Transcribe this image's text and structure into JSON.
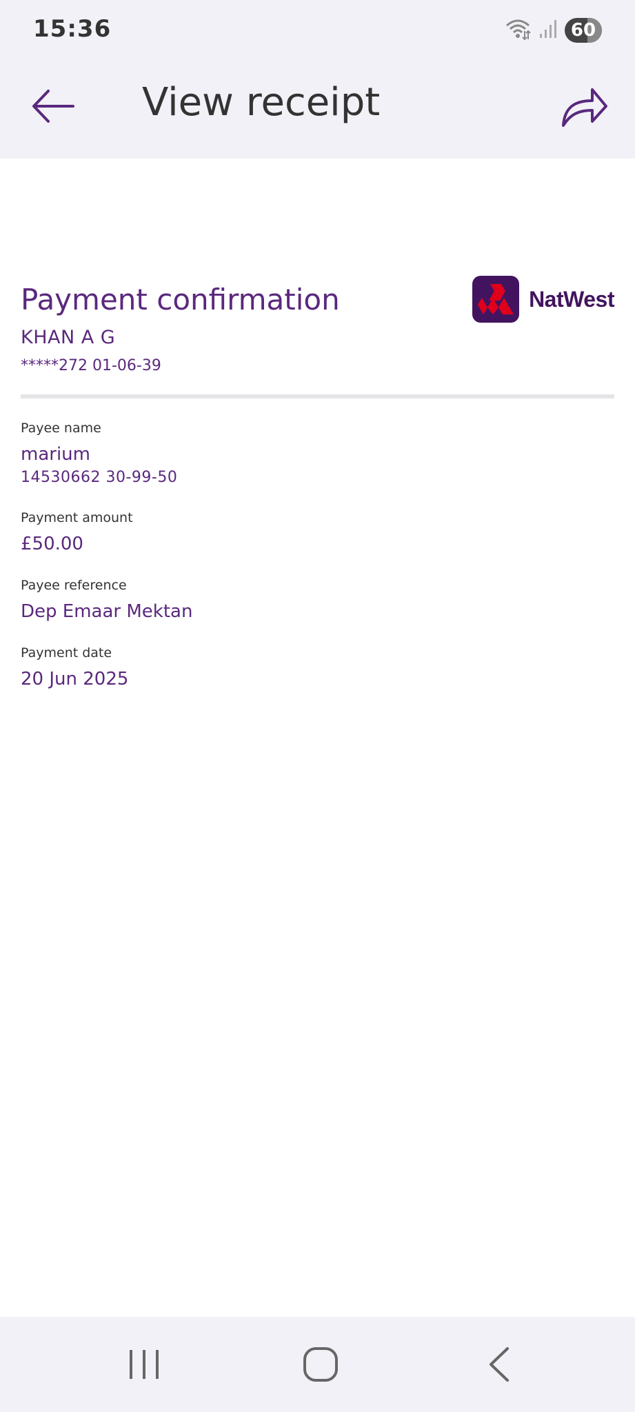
{
  "status_bar": {
    "time": "15:36",
    "battery_level": "60",
    "icons": [
      "wifi-icon",
      "signal-icon",
      "battery-icon"
    ]
  },
  "header": {
    "title": "View receipt",
    "back_icon": "arrow-left-icon",
    "share_icon": "share-icon"
  },
  "receipt": {
    "title": "Payment confirmation",
    "account_name": "KHAN A G",
    "account_number": "*****272 01-06-39",
    "brand_name": "NatWest",
    "fields": [
      {
        "label": "Payee name",
        "value": "marium",
        "sub": "14530662 30-99-50"
      },
      {
        "label": "Payment amount",
        "value": "£50.00"
      },
      {
        "label": "Payee reference",
        "value": "Dep Emaar Mektan"
      },
      {
        "label": "Payment date",
        "value": "20 Jun 2025"
      }
    ]
  },
  "colors": {
    "accent": "#5a287d",
    "brand_logo_bg": "#42145f",
    "brand_logo_cubes": "#e0001b",
    "background": "#f2f1f7",
    "card": "#ffffff"
  },
  "nav": {
    "icons": [
      "recent-apps-icon",
      "home-icon",
      "back-icon"
    ]
  }
}
